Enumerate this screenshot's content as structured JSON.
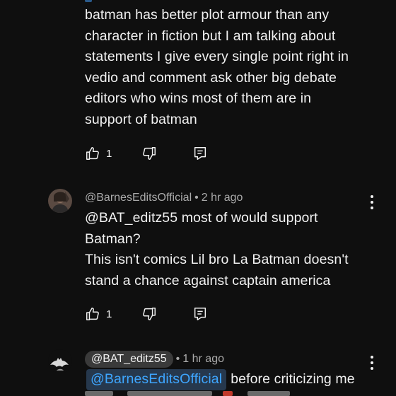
{
  "comments": [
    {
      "lines": [
        "batman has better plot armour than any",
        "character in fiction but I am talking about",
        "statements I give every single point right in",
        "vedio and comment ask other big debate",
        "editors who wins most of them are in",
        "support of batman"
      ],
      "like_count": "1"
    },
    {
      "author": "@BarnesEditsOfficial",
      "separator": "•",
      "time": "2 hr ago",
      "lines": [
        "@BAT_editz55 most of would support",
        "Batman?",
        "This isn't comics Lil bro La Batman doesn't",
        "stand a chance against captain america"
      ],
      "like_count": "1"
    },
    {
      "author": "@BAT_editz55",
      "separator": "•",
      "time": "1 hr ago",
      "mention": "@BarnesEditsOfficial",
      "text": "before criticizing me"
    }
  ],
  "icons": {
    "like": "thumb-up-icon",
    "dislike": "thumb-down-icon",
    "reply": "reply-comment-icon",
    "more": "more-vert-icon"
  },
  "colors": {
    "background": "#0f0f0f",
    "text": "#f1f1f1",
    "meta": "#aaaaaa",
    "mention": "#3ea6ff"
  }
}
